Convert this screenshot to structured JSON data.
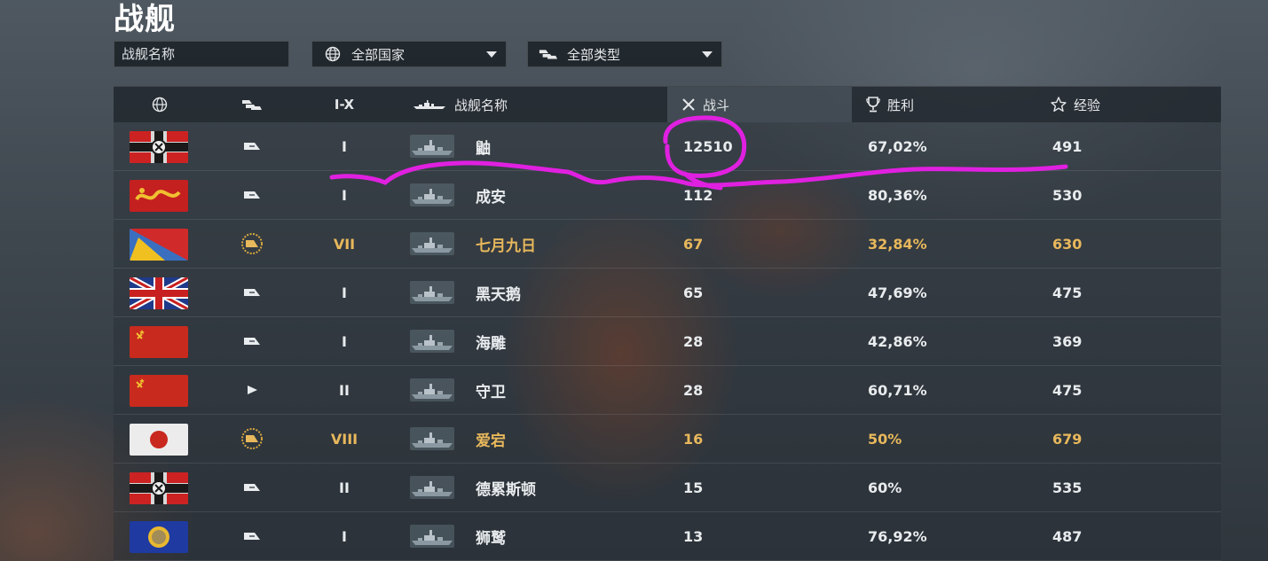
{
  "page": {
    "title": "战舰"
  },
  "filters": {
    "search_placeholder": "战舰名称",
    "nation_label": "全部国家",
    "type_label": "全部类型"
  },
  "table": {
    "headers": {
      "nation": "",
      "type": "",
      "tier": "I-X",
      "name": "战舰名称",
      "battles": "战斗",
      "wins": "胜利",
      "exp": "经验"
    },
    "rows": [
      {
        "flag": "germany",
        "type_icon": "destroyer-icon",
        "tier": "I",
        "name": "鼬",
        "battles": "12510",
        "wins": "67,02%",
        "exp": "491",
        "premium": false
      },
      {
        "flag": "pan-asia",
        "type_icon": "destroyer-icon",
        "tier": "I",
        "name": "成安",
        "battles": "112",
        "wins": "80,36%",
        "exp": "530",
        "premium": false
      },
      {
        "flag": "pan-america",
        "type_icon": "premium-destroyer-icon",
        "tier": "VII",
        "name": "七月九日",
        "battles": "67",
        "wins": "32,84%",
        "exp": "630",
        "premium": true
      },
      {
        "flag": "uk",
        "type_icon": "destroyer-icon",
        "tier": "I",
        "name": "黑天鹅",
        "battles": "65",
        "wins": "47,69%",
        "exp": "475",
        "premium": false
      },
      {
        "flag": "ussr",
        "type_icon": "destroyer-icon",
        "tier": "I",
        "name": "海雕",
        "battles": "28",
        "wins": "42,86%",
        "exp": "369",
        "premium": false
      },
      {
        "flag": "ussr",
        "type_icon": "small-destroyer-icon",
        "tier": "II",
        "name": "守卫",
        "battles": "28",
        "wins": "60,71%",
        "exp": "475",
        "premium": false
      },
      {
        "flag": "japan",
        "type_icon": "premium-destroyer-icon",
        "tier": "VIII",
        "name": "爱宕",
        "battles": "16",
        "wins": "50%",
        "exp": "679",
        "premium": true
      },
      {
        "flag": "germany",
        "type_icon": "destroyer-icon",
        "tier": "II",
        "name": "德累斯顿",
        "battles": "15",
        "wins": "60%",
        "exp": "535",
        "premium": false
      },
      {
        "flag": "europe",
        "type_icon": "destroyer-icon",
        "tier": "I",
        "name": "狮鹫",
        "battles": "13",
        "wins": "76,92%",
        "exp": "487",
        "premium": false
      }
    ]
  },
  "colors": {
    "premium_text": "#e8b85c",
    "annotation": "#e020e0"
  }
}
